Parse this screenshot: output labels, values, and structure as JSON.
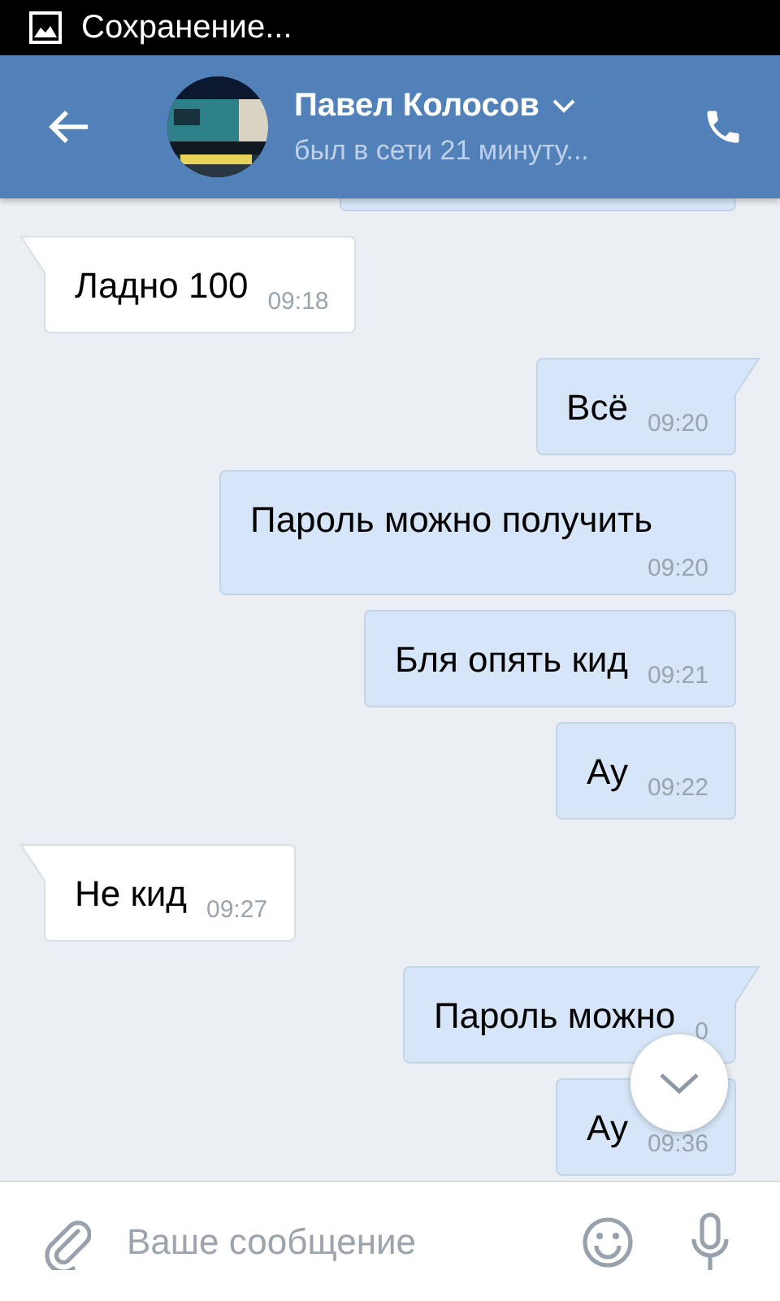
{
  "status_bar": {
    "text": "Сохранение..."
  },
  "header": {
    "name": "Павел Колосов",
    "status": "был в сети 21 минуту..."
  },
  "messages": [
    {
      "kind": "cut",
      "outgoing": true
    },
    {
      "kind": "text",
      "outgoing": false,
      "tail": true,
      "text": "Ладно 100",
      "time": "09:18"
    },
    {
      "kind": "text",
      "outgoing": true,
      "tail": true,
      "text": "Всё",
      "time": "09:20"
    },
    {
      "kind": "text",
      "outgoing": true,
      "tail": false,
      "text": "Пароль можно получить",
      "time": "09:20"
    },
    {
      "kind": "text",
      "outgoing": true,
      "tail": false,
      "text": "Бля опять кид",
      "time": "09:21"
    },
    {
      "kind": "text",
      "outgoing": true,
      "tail": false,
      "text": "Ау",
      "time": "09:22"
    },
    {
      "kind": "text",
      "outgoing": false,
      "tail": true,
      "text": "Не кид",
      "time": "09:27"
    },
    {
      "kind": "text",
      "outgoing": true,
      "tail": true,
      "text": "Пароль можно",
      "time": "0"
    },
    {
      "kind": "text",
      "outgoing": true,
      "tail": false,
      "text": "Ау",
      "time": "09:36"
    }
  ],
  "composer": {
    "placeholder": "Ваше сообщение"
  }
}
